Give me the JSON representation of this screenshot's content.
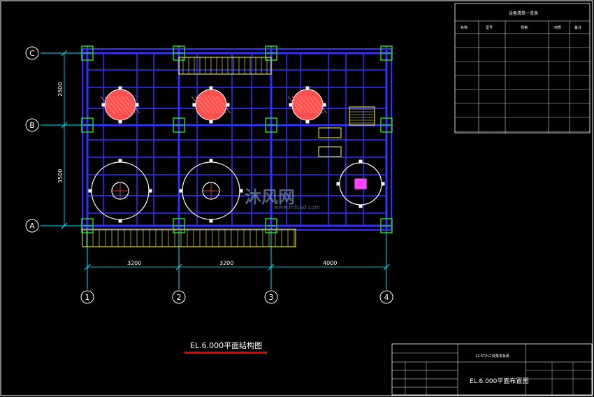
{
  "grid": {
    "row_labels": [
      "C",
      "B",
      "A"
    ],
    "col_labels": [
      "1",
      "2",
      "3",
      "4"
    ],
    "bay_dims_horizontal": [
      "3200",
      "3200",
      "4000"
    ],
    "bay_dims_vertical": [
      "2500",
      "3500"
    ]
  },
  "drawing": {
    "title": "EL.6.000平面结构图"
  },
  "equipment_table": {
    "title": "设备清单一览表",
    "headers": [
      "名称",
      "型号",
      "规格",
      "材质",
      "备注"
    ],
    "rows": 7
  },
  "title_block": {
    "project_name": "12.5T/h三效蒸发系统",
    "drawing_name": "EL.6.000平面布置图"
  },
  "watermark": {
    "text": "沐风网",
    "sub": "www.mfcad.com"
  },
  "colors": {
    "background": "#000000",
    "beam": "#3030ff",
    "grid_line": "#00e5ff",
    "column_box": "#33ff33",
    "platform": "#ffff33",
    "tank_hot": "#ff5050",
    "magenta": "#ff44ff",
    "title_underline": "#ee0000"
  }
}
